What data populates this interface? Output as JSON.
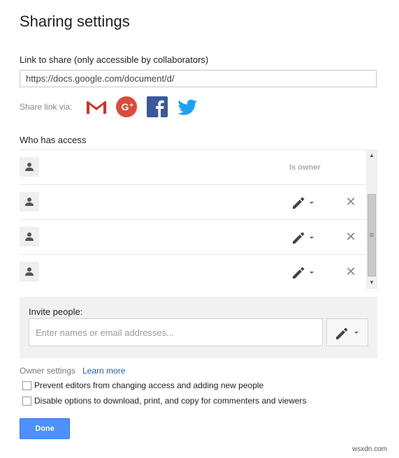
{
  "dialog": {
    "title": "Sharing settings"
  },
  "link_share": {
    "label": "Link to share (only accessible by collaborators)",
    "url": "https://docs.google.com/document/d/"
  },
  "share_via": {
    "label": "Share link via:",
    "icons": [
      "gmail-icon",
      "google-plus-icon",
      "facebook-icon",
      "twitter-icon"
    ]
  },
  "access": {
    "label": "Who has access",
    "rows": [
      {
        "role": "Is owner",
        "removable": false
      },
      {
        "role": "edit",
        "removable": true
      },
      {
        "role": "edit",
        "removable": true
      },
      {
        "role": "edit",
        "removable": true
      }
    ],
    "remove_glyph": "✕"
  },
  "invite": {
    "label": "Invite people:",
    "placeholder": "Enter names or email addresses..."
  },
  "owner_settings": {
    "label": "Owner settings",
    "learn_more": "Learn more",
    "options": [
      {
        "label": "Prevent editors from changing access and adding new people",
        "checked": false
      },
      {
        "label": "Disable options to download, print, and copy for commenters and viewers",
        "checked": false
      }
    ]
  },
  "buttons": {
    "done": "Done"
  },
  "colors": {
    "done_blue": "#4d90fe",
    "gmail_red": "#d93025",
    "google_plus_red": "#dd4b39",
    "facebook_blue": "#3b5998",
    "twitter_blue": "#1da1f2",
    "link_blue": "#1a5fc8"
  },
  "watermark": "wsxdn.com"
}
